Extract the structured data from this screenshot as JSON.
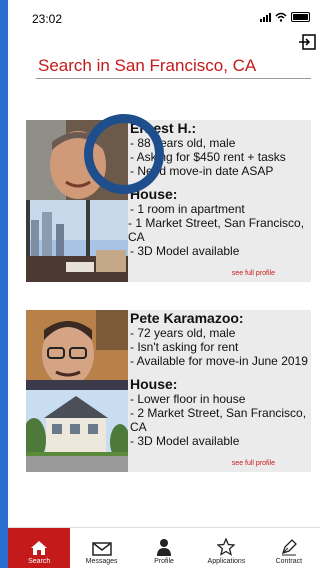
{
  "status": {
    "time": "23:02"
  },
  "header": {
    "title": "Search in San Francisco, CA"
  },
  "listings": [
    {
      "name": "Ernest H.:",
      "details": [
        "- 88 years old, male",
        "- Asking for $450 rent + tasks",
        "- Need move-in date ASAP"
      ],
      "house_heading": "House:",
      "house_details": [
        "- 1 room in apartment",
        "- 1 Market Street, San Francisco, CA",
        "- 3D Model available"
      ],
      "link": "see full profile"
    },
    {
      "name": "Pete Karamazoo:",
      "details": [
        "- 72 years old, male",
        "- Isn't asking for rent",
        "- Available for move-in June 2019"
      ],
      "house_heading": "House:",
      "house_details": [
        "- Lower floor in house",
        "- 2 Market Street, San Francisco, CA",
        "- 3D Model available"
      ],
      "link": "see full profile"
    }
  ],
  "tabs": [
    {
      "label": "Search",
      "icon": "home-icon"
    },
    {
      "label": "Messages",
      "icon": "mail-icon"
    },
    {
      "label": "Profile",
      "icon": "person-icon"
    },
    {
      "label": "Applications",
      "icon": "star-icon"
    },
    {
      "label": "Contract",
      "icon": "pen-icon"
    }
  ],
  "colors": {
    "accent": "#c41a1a",
    "background": "#2a6fd0",
    "ring": "#1e4e8c"
  }
}
